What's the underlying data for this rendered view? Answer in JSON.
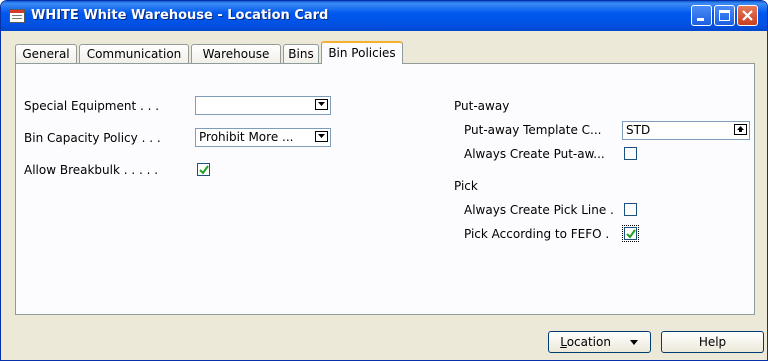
{
  "window": {
    "title": "WHITE White Warehouse - Location Card",
    "minimize_icon": "minimize-icon",
    "maximize_icon": "maximize-icon",
    "close_icon": "close-icon"
  },
  "tabs": [
    {
      "label": "General"
    },
    {
      "label": "Communication"
    },
    {
      "label": "Warehouse"
    },
    {
      "label": "Bins"
    },
    {
      "label": "Bin Policies",
      "active": true
    }
  ],
  "left_fields": {
    "special_equipment": {
      "label": "Special Equipment . . .",
      "value": ""
    },
    "bin_capacity_policy": {
      "label": "Bin Capacity Policy . . .",
      "value": "Prohibit More ..."
    },
    "allow_breakbulk": {
      "label": "Allow Breakbulk . . . . .",
      "checked": true
    }
  },
  "putaway": {
    "section_label": "Put-away",
    "template": {
      "label": "Put-away Template C...",
      "value": "STD"
    },
    "always_create": {
      "label": "Always Create Put-aw...",
      "checked": false
    }
  },
  "pick": {
    "section_label": "Pick",
    "always_create_pick_line": {
      "label": "Always Create Pick Line .",
      "checked": false
    },
    "pick_fefo": {
      "label": "Pick According to FEFO .",
      "checked": true
    }
  },
  "footer": {
    "location_button": {
      "underline": "L",
      "rest": "ocation"
    },
    "help_button": "Help"
  },
  "colors": {
    "titlebar": "#0058ee",
    "window_bg": "#ece9d8",
    "active_tab_accent": "#f4b030",
    "checkmark": "#21a121"
  }
}
